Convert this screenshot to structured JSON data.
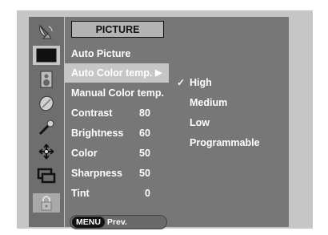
{
  "menu": {
    "title": "PICTURE",
    "items": [
      {
        "label": "Auto Picture",
        "value": ""
      },
      {
        "label": "Auto Color temp.",
        "value": "",
        "arrow": "▶"
      },
      {
        "label": "Manual Color temp.",
        "value": ""
      },
      {
        "label": "Contrast",
        "value": "80"
      },
      {
        "label": "Brightness",
        "value": "60"
      },
      {
        "label": "Color",
        "value": "50"
      },
      {
        "label": "Sharpness",
        "value": "50"
      },
      {
        "label": "Tint",
        "value": "0"
      }
    ],
    "prev_key": "MENU",
    "prev_label": "Prev."
  },
  "options": {
    "check_mark": "✓",
    "items": [
      {
        "label": "High",
        "selected": true
      },
      {
        "label": "Medium",
        "selected": false
      },
      {
        "label": "Low",
        "selected": false
      },
      {
        "label": "Programmable",
        "selected": false
      }
    ]
  },
  "rail_icons": [
    "satellite-dish-icon",
    "picture-screen-icon",
    "speaker-icon",
    "clock-icon",
    "key-icon",
    "arrows-cross-icon",
    "pip-icon",
    "lock-icon"
  ],
  "colors": {
    "screen_bg": "#c6c6c6",
    "panel_bg": "#777777",
    "rail_bg": "#6e6e6e",
    "text": "#ffffff"
  }
}
